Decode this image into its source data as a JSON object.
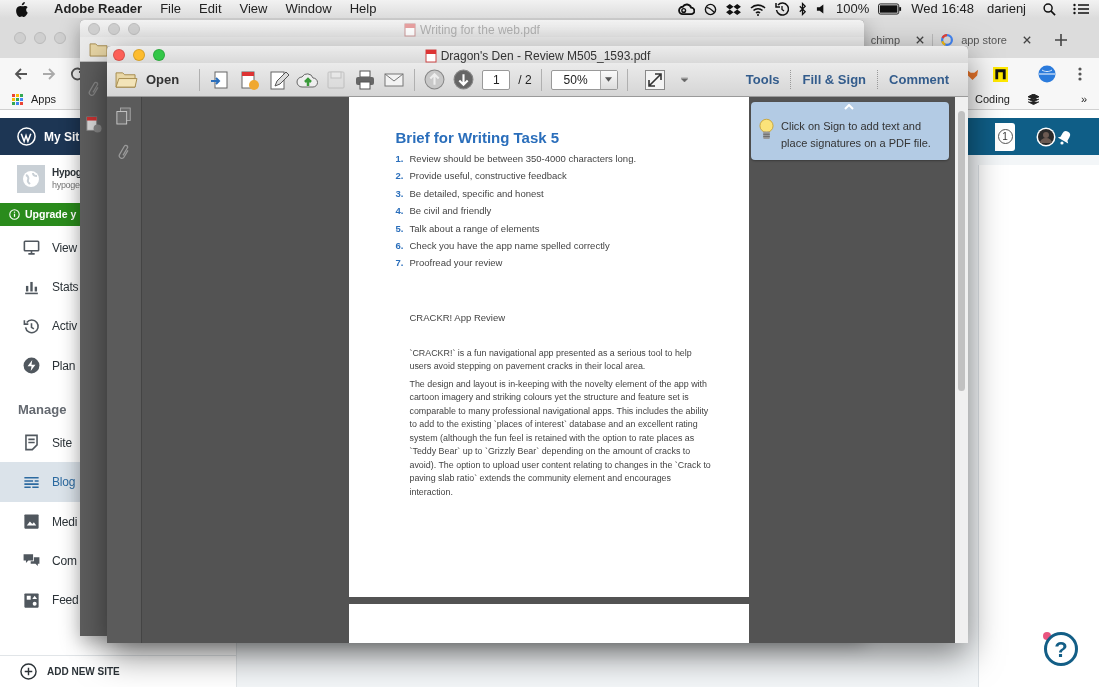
{
  "menu_bar": {
    "app_name": "Adobe Reader",
    "menus": [
      "File",
      "Edit",
      "View",
      "Window",
      "Help"
    ],
    "battery": "100%",
    "clock": "Wed 16:48",
    "user": "darienj"
  },
  "browser": {
    "tabs": [
      {
        "title": "chimp",
        "selected": false
      },
      {
        "title": "app store",
        "selected": false
      }
    ],
    "bookmarks": [
      "Apps",
      "Coding"
    ],
    "bookmarks_overflow": "»"
  },
  "wordpress": {
    "top_bar": {
      "title": "My Sit",
      "notification_count": "1"
    },
    "site": {
      "name": "Hypog",
      "address": "hypoge"
    },
    "upgrade_banner": "Upgrade y",
    "sections": [
      {
        "items": [
          {
            "label": "View",
            "kind": "monitor",
            "selected": false
          },
          {
            "label": "Stats",
            "kind": "stats",
            "selected": false
          },
          {
            "label": "Activ",
            "kind": "activity",
            "selected": false
          },
          {
            "label": "Plan",
            "kind": "plan",
            "selected": false
          }
        ]
      },
      {
        "heading": "Manage",
        "items": [
          {
            "label": "Site",
            "kind": "pages",
            "selected": false
          },
          {
            "label": "Blog",
            "kind": "blog",
            "selected": true
          },
          {
            "label": "Medi",
            "kind": "media",
            "selected": false
          },
          {
            "label": "Com",
            "kind": "comments",
            "selected": false
          },
          {
            "label": "Feed",
            "kind": "feedback",
            "selected": false
          }
        ]
      }
    ],
    "add_site": "ADD NEW SITE"
  },
  "back_window": {
    "title": "Writing for the web.pdf"
  },
  "reader": {
    "title": "Dragon's Den - Review M505_1593.pdf",
    "open_button": "Open",
    "tools": [
      {
        "kind": "create",
        "disabled": false
      },
      {
        "kind": "share",
        "disabled": false
      },
      {
        "kind": "edit",
        "disabled": false
      },
      {
        "kind": "upload",
        "disabled": false
      },
      {
        "kind": "save",
        "disabled": true
      },
      {
        "kind": "print",
        "disabled": false
      },
      {
        "kind": "email",
        "disabled": false
      }
    ],
    "page_buttons": [
      {
        "kind": "up",
        "disabled": true
      },
      {
        "kind": "down",
        "disabled": false
      }
    ],
    "page": "1",
    "page_count": "/ 2",
    "zoom": "50%",
    "panes": [
      "Tools",
      "Fill & Sign",
      "Comment"
    ],
    "document": {
      "heading": "Brief for Writing Task 5",
      "brief": [
        {
          "number": "1.",
          "text": "Review should be between 350-4000 characters long."
        },
        {
          "number": "2.",
          "text": "Provide useful, constructive feedback"
        },
        {
          "number": "3.",
          "text": "Be detailed, specific and honest"
        },
        {
          "number": "4.",
          "text": "Be civil and friendly"
        },
        {
          "number": "5.",
          "text": "Talk about a range of elements"
        },
        {
          "number": "6.",
          "text": "Check you have the app name spelled correctly"
        },
        {
          "number": "7.",
          "text": "Proofread your review"
        }
      ],
      "review_title": "CRACKR! App Review",
      "paragraphs": [
        "`CRACKR!` is a fun navigational app presented as a serious tool to help users avoid stepping on pavement cracks in their local area.",
        "The design and layout is in-keeping with the novelty element of the app with cartoon imagery and striking colours yet the structure and feature set is comparable to many professional navigational apps. This includes the ability to add to the existing `places of interest` database and an excellent rating system (although the fun feel is retained with the option to rate places as `Teddy Bear` up to  `Grizzly Bear` depending on the amount of cracks to avoid). The option to upload user content relating to changes in the `Crack to paving slab ratio` extends the community element and encourages interaction."
      ]
    },
    "tip": "Click on Sign to add text and place signatures on a PDF file."
  },
  "help_button": "?"
}
